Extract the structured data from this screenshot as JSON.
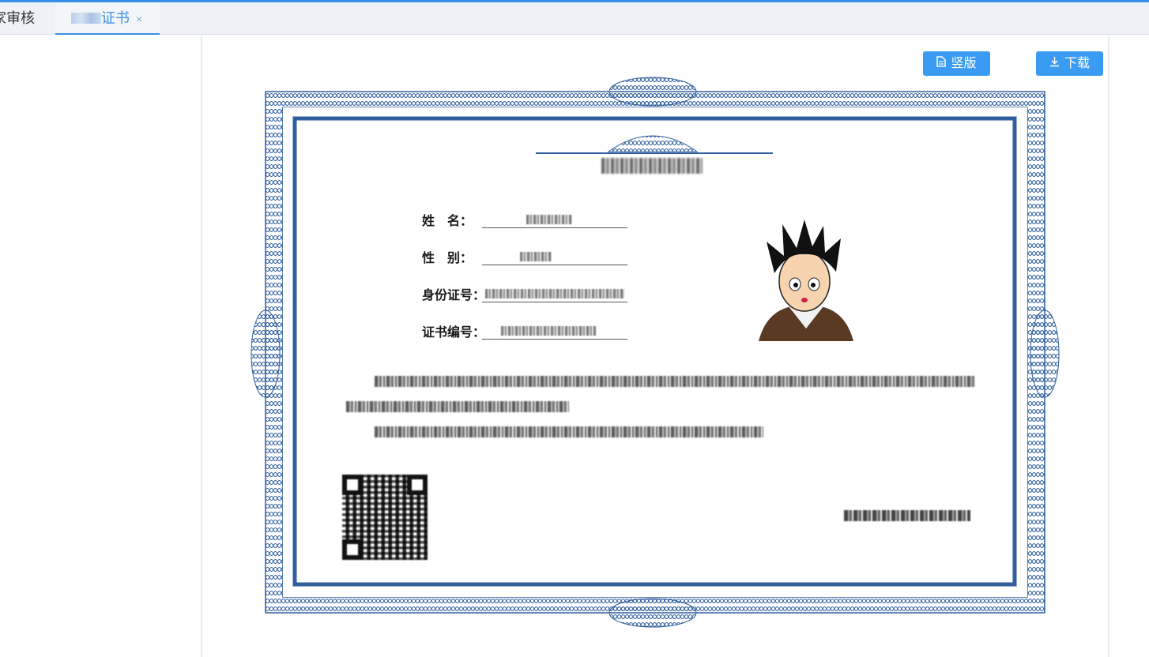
{
  "tabs": [
    {
      "label": "家审核"
    },
    {
      "label": "证书",
      "close": "×"
    }
  ],
  "toolbar": {
    "vertical_label": "竖版",
    "download_label": "下载",
    "vertical_icon": "document-icon",
    "download_icon": "download-icon"
  },
  "certificate": {
    "fields": [
      {
        "label": "姓　名："
      },
      {
        "label": "性　别："
      },
      {
        "label": "身份证号："
      },
      {
        "label": "证书编号："
      }
    ]
  },
  "colors": {
    "accent": "#3a8ee6",
    "button": "#3a9bf2",
    "frame": "#2f5f9e"
  }
}
